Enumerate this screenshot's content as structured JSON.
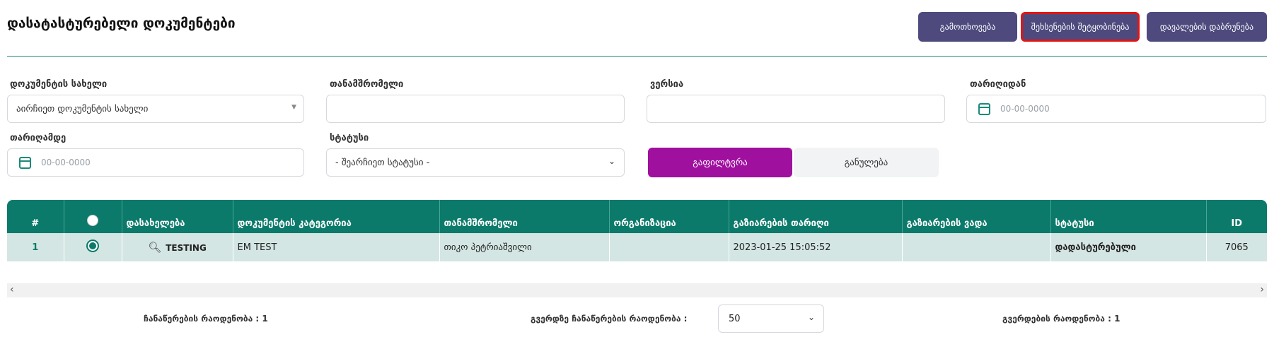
{
  "header": {
    "title": "დასატასტურებელი დოკუმენტები",
    "buttons": {
      "request": "გამოთხოვება",
      "notify": "შეხსენების შეტყობინება",
      "return": "დავალების დაბრუნება"
    },
    "highlight_color": "#e01515"
  },
  "filters": {
    "doc_name_label": "დოკუმენტის სახელი",
    "doc_name_value": "აირჩიეთ დოკუმენტის სახელი",
    "employee_label": "თანამშრომელი",
    "version_label": "ვერსია",
    "date_from_label": "თარიღიდან",
    "date_from_placeholder": "00-00-0000",
    "date_to_label": "თარიღამდე",
    "date_to_placeholder": "00-00-0000",
    "status_label": "სტატუსი",
    "status_value": "- შეარჩიეთ სტატუსი -",
    "filter_button": "გაფილტვრა",
    "reset_button": "განულება",
    "filter_color": "#a0109f"
  },
  "table": {
    "header_color": "#0b7a6a",
    "columns": [
      "#",
      "",
      "დასახელება",
      "დოკუმენტის კატეგორია",
      "თანამშრომელი",
      "ორგანიზაცია",
      "გაზიარების თარიღი",
      "გაზიარების ვადა",
      "სტატუსი",
      "ID"
    ],
    "rows": [
      {
        "num": "1",
        "name": "TESTING",
        "category": "EM TEST",
        "employee": "თიკო პეტრიაშვილი",
        "organization": "",
        "share_date": "2023-01-25 15:05:52",
        "share_deadline": "",
        "status": "დადასტურებული",
        "id": "7065"
      }
    ]
  },
  "footer": {
    "records_count": "ჩანაწერების რაოდენობა : 1",
    "per_page_label": "გვერდზე ჩანაწერების რაოდენობა :",
    "per_page_value": "50",
    "pages_count": "გვერდების რაოდენობა : 1"
  }
}
